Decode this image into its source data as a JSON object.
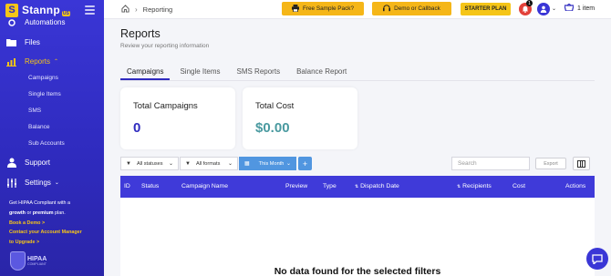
{
  "colors": {
    "sidebar": "#3a36d6",
    "accent": "#f5c518",
    "table_header": "#3f3ad9",
    "filter_active": "#5196e0",
    "total_campaigns": "#2f2bbf",
    "total_cost": "#4a9aa0"
  },
  "brand": {
    "name": "Stannp",
    "badge": "US"
  },
  "sidebar": {
    "items": [
      {
        "label": "Automations",
        "icon": "automations-icon"
      },
      {
        "label": "Files",
        "icon": "folder-icon"
      },
      {
        "label": "Reports",
        "icon": "reports-icon"
      },
      {
        "label": "Support",
        "icon": "support-icon"
      },
      {
        "label": "Settings",
        "icon": "sliders-icon"
      }
    ],
    "sub_items": [
      "Campaigns",
      "Single Items",
      "SMS",
      "Balance",
      "Sub Accounts"
    ],
    "promo": {
      "l1": "Get HIPAA Compliant with a",
      "l2a": "growth",
      "l2b": " or ",
      "l2c": "premium",
      "l2d": " plan.",
      "l3": "Book a Demo >",
      "l4": "Contact your Account Manager",
      "l5": "to Upgrade >"
    },
    "hipaa": {
      "title": "HIPAA",
      "sub": "COMPLIANT"
    }
  },
  "topbar": {
    "breadcrumb": "Reporting",
    "sample_pack": "Free Sample Pack?",
    "demo": "Demo or Callback",
    "plan": "STARTER PLAN",
    "notifications": "1",
    "cart": "1 item"
  },
  "page": {
    "title": "Reports",
    "subtitle": "Review your reporting information"
  },
  "tabs": [
    "Campaigns",
    "Single Items",
    "SMS Reports",
    "Balance Report"
  ],
  "cards": {
    "campaigns": {
      "label": "Total Campaigns",
      "value": "0"
    },
    "cost": {
      "label": "Total Cost",
      "value": "$0.00"
    }
  },
  "filters": {
    "statuses": "All statuses",
    "formats": "All formats",
    "month": "This Month",
    "search_placeholder": "Search",
    "export": "Export"
  },
  "table": {
    "columns": [
      "ID",
      "Status",
      "Campaign Name",
      "Preview",
      "Type",
      "Dispatch Date",
      "Recipients",
      "Cost",
      "Actions"
    ],
    "empty": "No data found for the selected filters"
  }
}
